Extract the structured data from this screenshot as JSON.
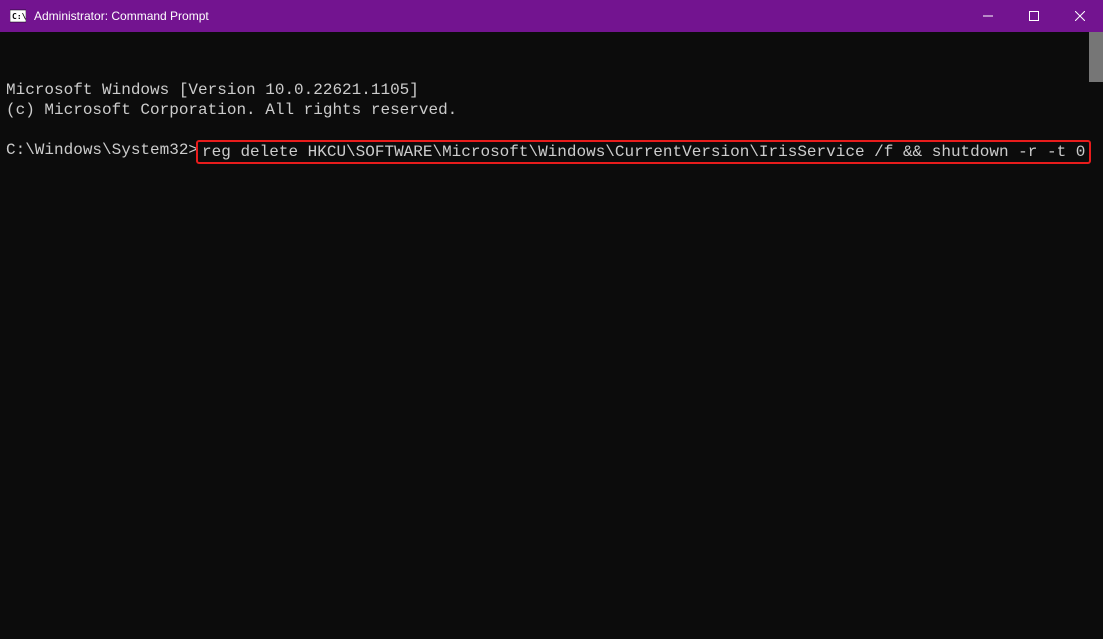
{
  "titlebar": {
    "title": "Administrator: Command Prompt"
  },
  "terminal": {
    "line1": "Microsoft Windows [Version 10.0.22621.1105]",
    "line2": "(c) Microsoft Corporation. All rights reserved.",
    "prompt": "C:\\Windows\\System32>",
    "command": "reg delete HKCU\\SOFTWARE\\Microsoft\\Windows\\CurrentVersion\\IrisService /f && shutdown -r -t 0"
  }
}
